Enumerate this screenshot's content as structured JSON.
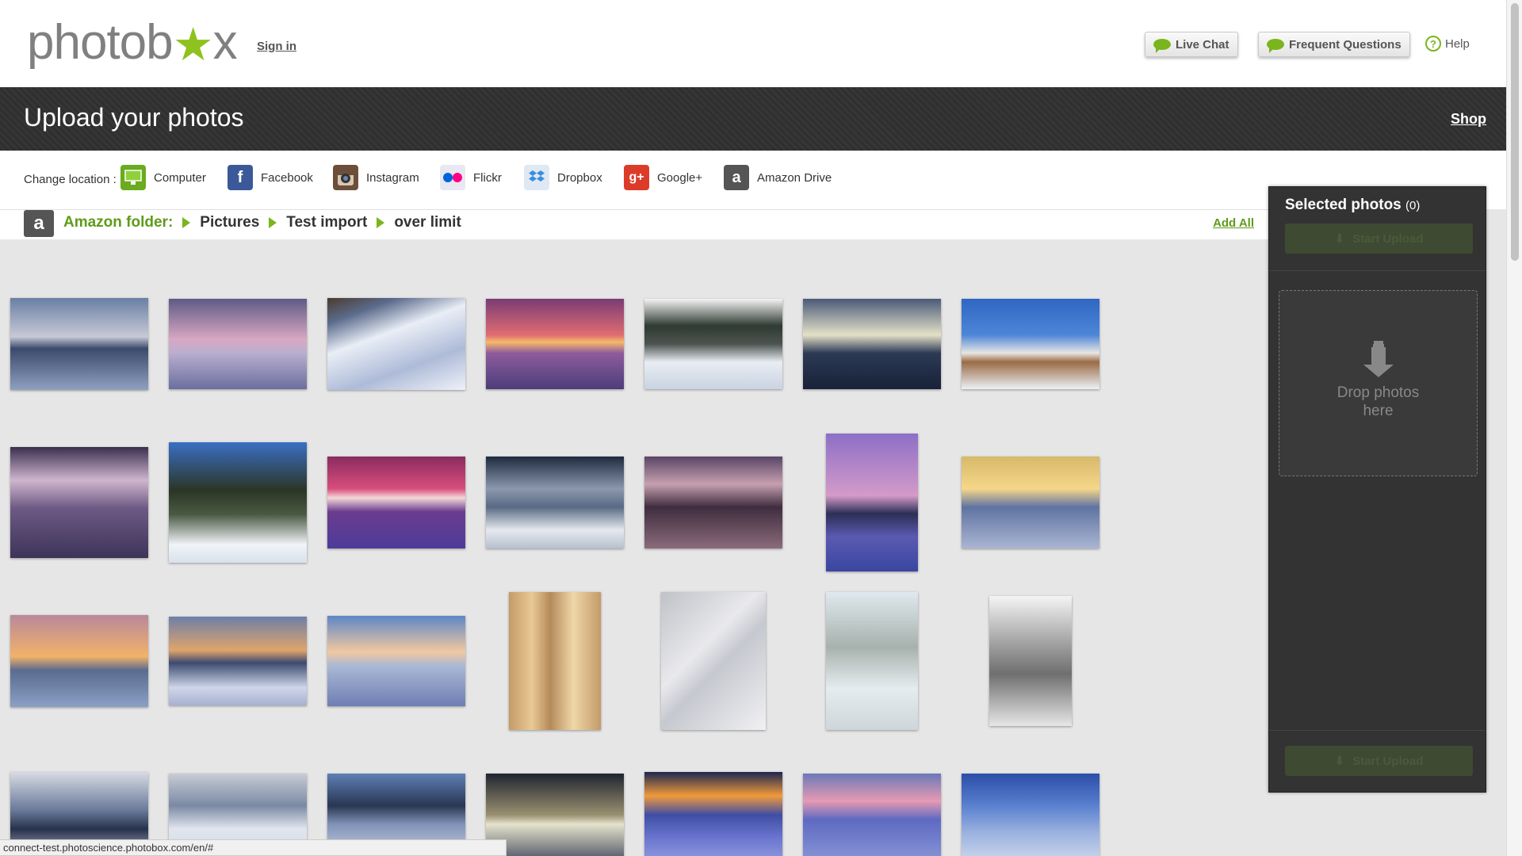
{
  "header": {
    "logo_text_left": "photob",
    "logo_star": "★",
    "logo_text_right": "x",
    "sign_in": "Sign in",
    "live_chat": "Live Chat",
    "faq": "Frequent Questions",
    "help": "Help",
    "help_glyph": "?"
  },
  "titlebar": {
    "title": "Upload your photos",
    "shop": "Shop"
  },
  "location": {
    "label": "Change location :",
    "items": [
      {
        "name": "Computer",
        "icon": "monitor-icon",
        "color": "#6aab1f"
      },
      {
        "name": "Facebook",
        "icon": "facebook-icon",
        "color": "#3b5998"
      },
      {
        "name": "Instagram",
        "icon": "instagram-icon",
        "color": "#6b4f3b"
      },
      {
        "name": "Flickr",
        "icon": "flickr-icon",
        "color": "#e8e8f2"
      },
      {
        "name": "Dropbox",
        "icon": "dropbox-icon",
        "color": "#dfe9f3"
      },
      {
        "name": "Google+",
        "icon": "googleplus-icon",
        "color": "#dd3b2a"
      },
      {
        "name": "Amazon Drive",
        "icon": "amazon-icon",
        "color": "#555555"
      }
    ]
  },
  "breadcrumb": {
    "badge": "a",
    "root": "Amazon folder:",
    "path": [
      "Pictures",
      "Test import",
      "over limit"
    ],
    "add_all": "Add All"
  },
  "photos": [
    {
      "bg": "linear-gradient(180deg,#6a7fa3 0%,#c7c9d6 42%,#3b4a6b 55%,#8fa0c0 100%)"
    },
    {
      "bg": "linear-gradient(180deg,#5e5a86 0%,#d9a8c3 45%,#b9aed0 60%,#6a6f9e 100%)"
    },
    {
      "bg": "linear-gradient(160deg,#4a3b2e 0%,#5b6b8c 18%,#e9eef6 40%,#aebbd8 70%,#eef1f8 100%)"
    },
    {
      "bg": "linear-gradient(180deg,#7a3c74 0%,#e06c72 40%,#f6b96a 48%,#8e5c9c 60%,#4d3d7a 100%)"
    },
    {
      "bg": "linear-gradient(180deg,#f4f4f4 0%,#2f3a33 30%,#4c5450 50%,#e9edf3 70%,#c9d3e2 100%)"
    },
    {
      "bg": "linear-gradient(180deg,#4a5a78 0%,#e5e1c8 40%,#2c3a55 60%,#182238 100%)"
    },
    {
      "bg": "linear-gradient(180deg,#2f66c2 0%,#4d86d8 40%,#e8e6e2 60%,#9a6b45 70%,#edf1f7 100%)"
    },
    {
      "bg": "linear-gradient(180deg,#3a2f4f 0%,#cfb6cf 30%,#6d5a84 55%,#3d3458 100%)"
    },
    {
      "bg": "linear-gradient(180deg,#3a6fc4 0%,#2b3524 40%,#4a5a44 60%,#f1f4f8 85%,#d9e1ec 100%)"
    },
    {
      "bg": "linear-gradient(180deg,#8a2b5f 0%,#d84e7c 35%,#f4d7d7 45%,#6a3c8f 60%,#4d3b99 100%)"
    },
    {
      "bg": "linear-gradient(180deg,#1e2a3e 0%,#8b98ae 35%,#5a6a84 55%,#e5e9ef 80%,#b7c0ce 100%)"
    },
    {
      "bg": "linear-gradient(180deg,#5a4566 0%,#c7a0b0 30%,#3f2d3f 55%,#8b6b7a 100%)"
    },
    {
      "bg": "linear-gradient(180deg,#8c6fc6 0%,#d49ac9 45%,#2c2f55 58%,#5a5ab2 75%,#3a46a0 100%)"
    },
    {
      "bg": "linear-gradient(180deg,#d7b96a 0%,#f6d78a 35%,#5f73a2 55%,#aab6d2 100%)"
    },
    {
      "bg": "linear-gradient(180deg,#b9889a 0%,#f2b26a 45%,#5a6b8f 60%,#8aa0c4 100%)"
    },
    {
      "bg": "linear-gradient(180deg,#6e7fa8 0%,#e0a46b 38%,#3b4a70 52%,#cfd6ea 80%,#a7b1d0 100%)"
    },
    {
      "bg": "linear-gradient(180deg,#5d87c7 0%,#f2c8a0 40%,#aab9d4 55%,#6e7eb3 100%)"
    },
    {
      "bg": "linear-gradient(90deg,#c49b67 0%,#e9c994 25%,#b48a5a 45%,#f0d7a8 70%,#c39a68 100%)"
    },
    {
      "bg": "linear-gradient(135deg,#bfc2c8 0%,#e9e9ec 40%,#c6c8cf 55%,#f1f1f3 100%)"
    },
    {
      "bg": "linear-gradient(180deg,#dfe9ee 0%,#a7b2ad 40%,#e5ecef 70%,#cdd6da 100%)"
    },
    {
      "bg": "linear-gradient(180deg,#f4f4f4 0%,#9a9a9a 40%,#6f6f6f 60%,#e6e6e6 100%)"
    },
    {
      "bg": "linear-gradient(180deg,#d8dbe3 0%,#6a7a9a 40%,#27324b 60%,#dfe3ec 100%)"
    },
    {
      "bg": "linear-gradient(180deg,#c8ccd6 0%,#7a8aa4 35%,#e1e5ee 60%,#cfd5e0 100%)"
    },
    {
      "bg": "linear-gradient(180deg,#5e7fb5 0%,#2a3652 35%,#7f92b7 55%,#dde3ee 100%)"
    },
    {
      "bg": "linear-gradient(180deg,#1f2430 0%,#9a9070 45%,#e5e2cc 55%,#3a4156 100%)"
    },
    {
      "bg": "linear-gradient(180deg,#1d2750 0%,#f29a3a 25%,#3f4ea5 45%,#6b76d0 70%,#9aa3e0 100%)"
    },
    {
      "bg": "linear-gradient(180deg,#6a79b8 0%,#e79ab2 30%,#5d6ac2 50%,#8d99d8 100%)"
    },
    {
      "bg": "linear-gradient(180deg,#2b4ea8 0%,#5a80cf 35%,#9cb3df 65%,#d2dcef 100%)"
    }
  ],
  "sidebar": {
    "title": "Selected photos",
    "count": "(0)",
    "start_upload": "Start Upload",
    "drop_text": "Drop photos here"
  },
  "status_url": "connect-test.photoscience.photobox.com/en/#"
}
